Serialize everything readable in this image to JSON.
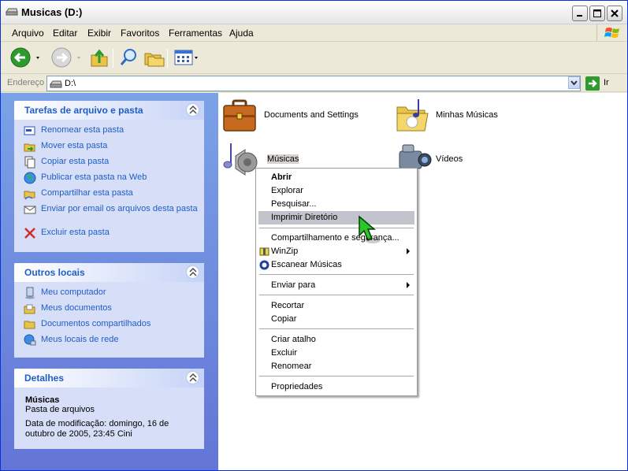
{
  "window": {
    "title": "Musicas (D:)"
  },
  "menubar": [
    "Arquivo",
    "Editar",
    "Exibir",
    "Favoritos",
    "Ferramentas",
    "Ajuda"
  ],
  "address": {
    "label": "Endereço",
    "value": "D:\\",
    "go": "Ir"
  },
  "panels": {
    "tasks": {
      "title": "Tarefas de arquivo e pasta",
      "items": [
        "Renomear esta pasta",
        "Mover esta pasta",
        "Copiar esta pasta",
        "Publicar esta pasta na Web",
        "Compartilhar esta pasta",
        "Enviar por email os arquivos desta pasta",
        "Excluir esta pasta"
      ]
    },
    "places": {
      "title": "Outros locais",
      "items": [
        "Meu computador",
        "Meus documentos",
        "Documentos compartilhados",
        "Meus locais de rede"
      ]
    },
    "details": {
      "title": "Detalhes",
      "name": "Músicas",
      "type": "Pasta de arquivos",
      "modified": "Data de modificação: domingo, 16 de outubro de 2005, 23:45 Cini"
    }
  },
  "folders": {
    "docs": "Documents and Settings",
    "minhas": "Minhas Músicas",
    "musicas": "Músicas",
    "videos": "Vídeos"
  },
  "context_menu": {
    "open": "Abrir",
    "explore": "Explorar",
    "search": "Pesquisar...",
    "print_dir": "Imprimir Diretório",
    "sharing": "Compartilhamento e segurança...",
    "winzip": "WinZip",
    "scan": "Escanear Músicas",
    "send_to": "Enviar para",
    "cut": "Recortar",
    "copy": "Copiar",
    "shortcut": "Criar atalho",
    "delete": "Excluir",
    "rename": "Renomear",
    "properties": "Propriedades"
  }
}
